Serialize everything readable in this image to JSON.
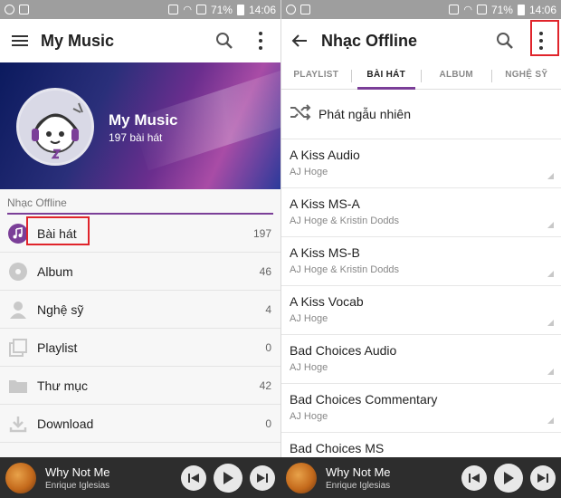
{
  "status_bar": {
    "battery": "71%",
    "time": "14:06"
  },
  "left": {
    "title": "My Music",
    "banner": {
      "name": "My Music",
      "count": "197 bài hát"
    },
    "section": "Nhạc Offline",
    "items": [
      {
        "label": "Bài hát",
        "count": "197",
        "icon": "music-note-icon"
      },
      {
        "label": "Album",
        "count": "46",
        "icon": "disc-icon"
      },
      {
        "label": "Nghệ sỹ",
        "count": "4",
        "icon": "person-icon"
      },
      {
        "label": "Playlist",
        "count": "0",
        "icon": "playlist-icon"
      },
      {
        "label": "Thư mục",
        "count": "42",
        "icon": "folder-icon"
      },
      {
        "label": "Download",
        "count": "0",
        "icon": "download-icon"
      }
    ]
  },
  "right": {
    "title": "Nhạc Offline",
    "tabs": [
      "PLAYLIST",
      "BÀI HÁT",
      "ALBUM",
      "NGHỆ SỸ"
    ],
    "active_tab": "BÀI HÁT",
    "shuffle": "Phát ngẫu nhiên",
    "songs": [
      {
        "title": "A Kiss Audio",
        "artist": "AJ Hoge"
      },
      {
        "title": "A Kiss MS-A",
        "artist": "AJ Hoge & Kristin Dodds"
      },
      {
        "title": "A Kiss MS-B",
        "artist": "AJ Hoge & Kristin Dodds"
      },
      {
        "title": "A Kiss Vocab",
        "artist": "AJ Hoge"
      },
      {
        "title": "Bad Choices Audio",
        "artist": "AJ Hoge"
      },
      {
        "title": "Bad Choices Commentary",
        "artist": "AJ Hoge"
      },
      {
        "title": "Bad Choices MS",
        "artist": ""
      }
    ]
  },
  "player": {
    "title": "Why Not Me",
    "artist": "Enrique Iglesias"
  },
  "colors": {
    "accent": "#7b3f98",
    "highlight": "#e0242b",
    "player_bg": "#2d2d2d"
  }
}
